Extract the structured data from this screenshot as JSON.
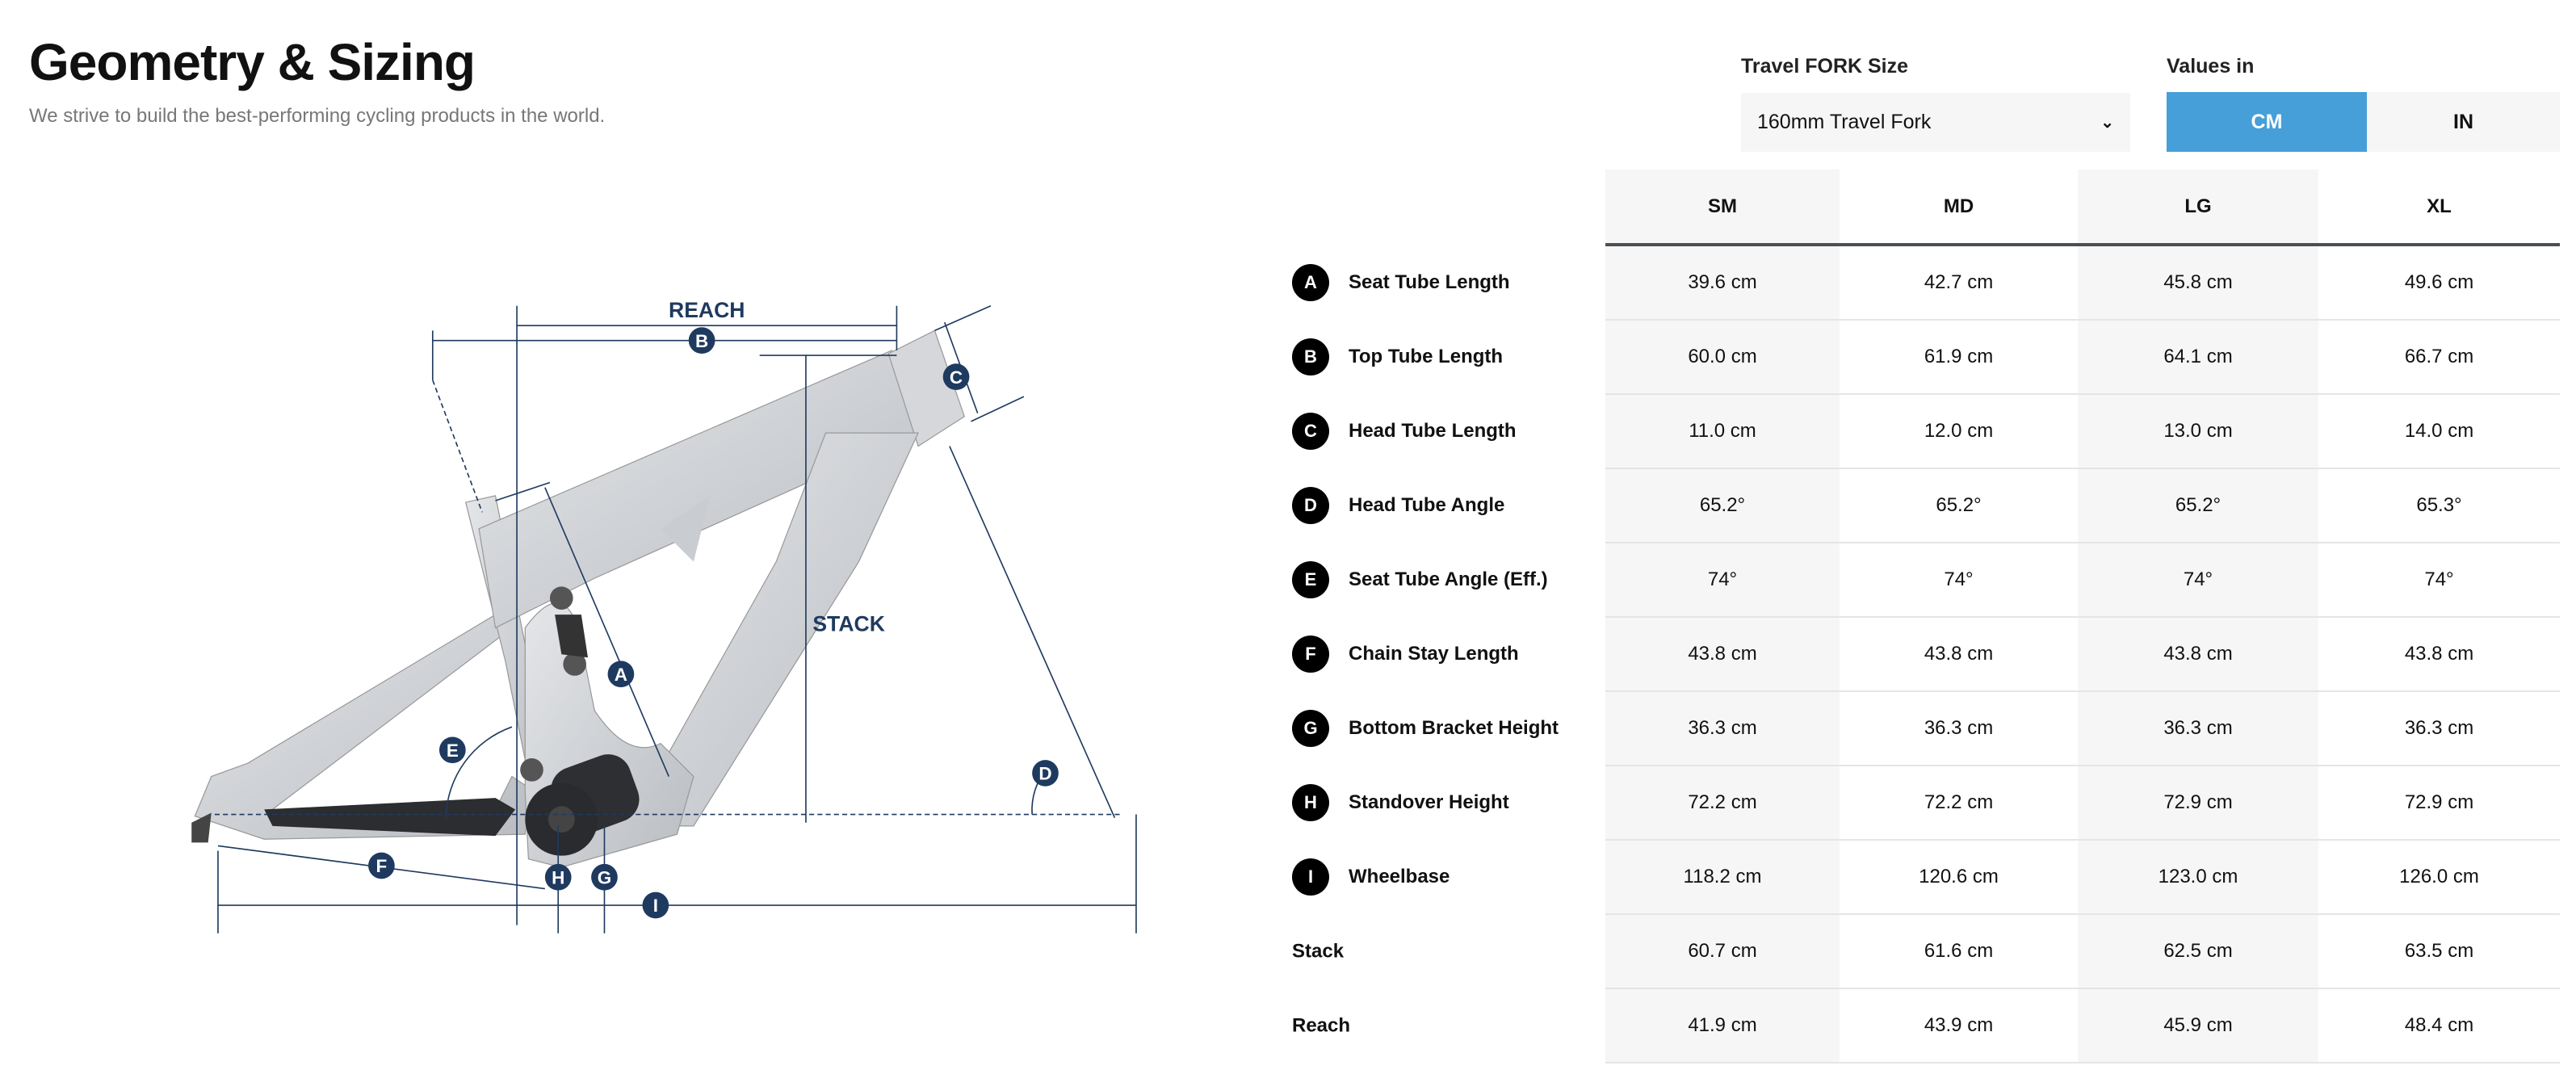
{
  "header": {
    "title": "Geometry & Sizing",
    "subtitle": "We strive to build the best-performing cycling products in the world."
  },
  "controls": {
    "fork_label": "Travel FORK Size",
    "fork_value": "160mm Travel Fork",
    "units_label": "Values in",
    "units": [
      {
        "label": "CM",
        "selected": true
      },
      {
        "label": "IN",
        "selected": false
      }
    ],
    "accent_color": "#469fd8"
  },
  "diagram": {
    "reach_label": "REACH",
    "stack_label": "STACK",
    "markers": [
      "A",
      "B",
      "C",
      "D",
      "E",
      "F",
      "G",
      "H",
      "I"
    ],
    "line_color": "#1f3a5f"
  },
  "table": {
    "sizes": [
      "SM",
      "MD",
      "LG",
      "XL"
    ],
    "rows": [
      {
        "badge": "A",
        "label": "Seat Tube Length",
        "values": [
          "39.6 cm",
          "42.7 cm",
          "45.8 cm",
          "49.6 cm"
        ]
      },
      {
        "badge": "B",
        "label": "Top Tube Length",
        "values": [
          "60.0 cm",
          "61.9 cm",
          "64.1 cm",
          "66.7 cm"
        ]
      },
      {
        "badge": "C",
        "label": "Head Tube Length",
        "values": [
          "11.0 cm",
          "12.0 cm",
          "13.0 cm",
          "14.0 cm"
        ]
      },
      {
        "badge": "D",
        "label": "Head Tube Angle",
        "values": [
          "65.2°",
          "65.2°",
          "65.2°",
          "65.3°"
        ]
      },
      {
        "badge": "E",
        "label": "Seat Tube Angle (Eff.)",
        "values": [
          "74°",
          "74°",
          "74°",
          "74°"
        ]
      },
      {
        "badge": "F",
        "label": "Chain Stay Length",
        "values": [
          "43.8 cm",
          "43.8 cm",
          "43.8 cm",
          "43.8 cm"
        ]
      },
      {
        "badge": "G",
        "label": "Bottom Bracket Height",
        "values": [
          "36.3 cm",
          "36.3 cm",
          "36.3 cm",
          "36.3 cm"
        ]
      },
      {
        "badge": "H",
        "label": "Standover Height",
        "values": [
          "72.2 cm",
          "72.2 cm",
          "72.9 cm",
          "72.9 cm"
        ]
      },
      {
        "badge": "I",
        "label": "Wheelbase",
        "values": [
          "118.2 cm",
          "120.6 cm",
          "123.0 cm",
          "126.0 cm"
        ]
      },
      {
        "badge": "",
        "label": "Stack",
        "values": [
          "60.7 cm",
          "61.6 cm",
          "62.5 cm",
          "63.5 cm"
        ]
      },
      {
        "badge": "",
        "label": "Reach",
        "values": [
          "41.9 cm",
          "43.9 cm",
          "45.9 cm",
          "48.4 cm"
        ]
      }
    ]
  }
}
